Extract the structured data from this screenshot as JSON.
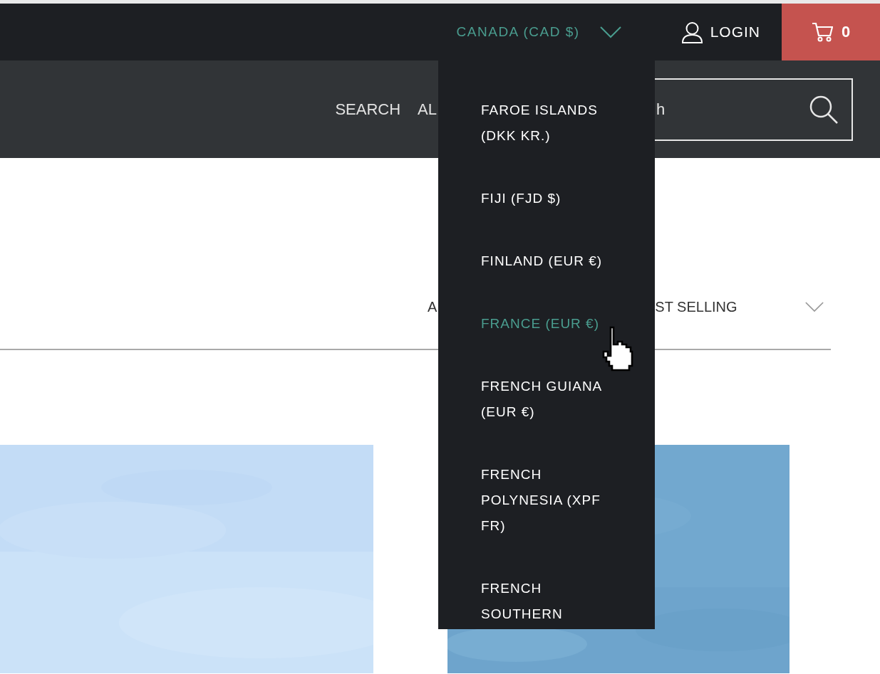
{
  "header": {
    "currency": "CANADA (CAD $)",
    "login": "LOGIN",
    "cart_count": "0"
  },
  "nav": {
    "links": [
      "SEARCH",
      "AL"
    ],
    "search": {
      "placeholder": "h"
    }
  },
  "sort": {
    "left_label": "A",
    "value": "ST SELLING"
  },
  "currency_menu": {
    "items": [
      {
        "label": "FAROE ISLANDS (DKK KR.)",
        "selected": false
      },
      {
        "label": "FIJI (FJD $)",
        "selected": false
      },
      {
        "label": "FINLAND (EUR €)",
        "selected": false
      },
      {
        "label": "FRANCE (EUR €)",
        "selected": true
      },
      {
        "label": "FRENCH GUIANA (EUR €)",
        "selected": false
      },
      {
        "label": "FRENCH POLYNESIA (XPF FR)",
        "selected": false
      },
      {
        "label": "FRENCH SOUTHERN",
        "selected": false
      }
    ]
  }
}
